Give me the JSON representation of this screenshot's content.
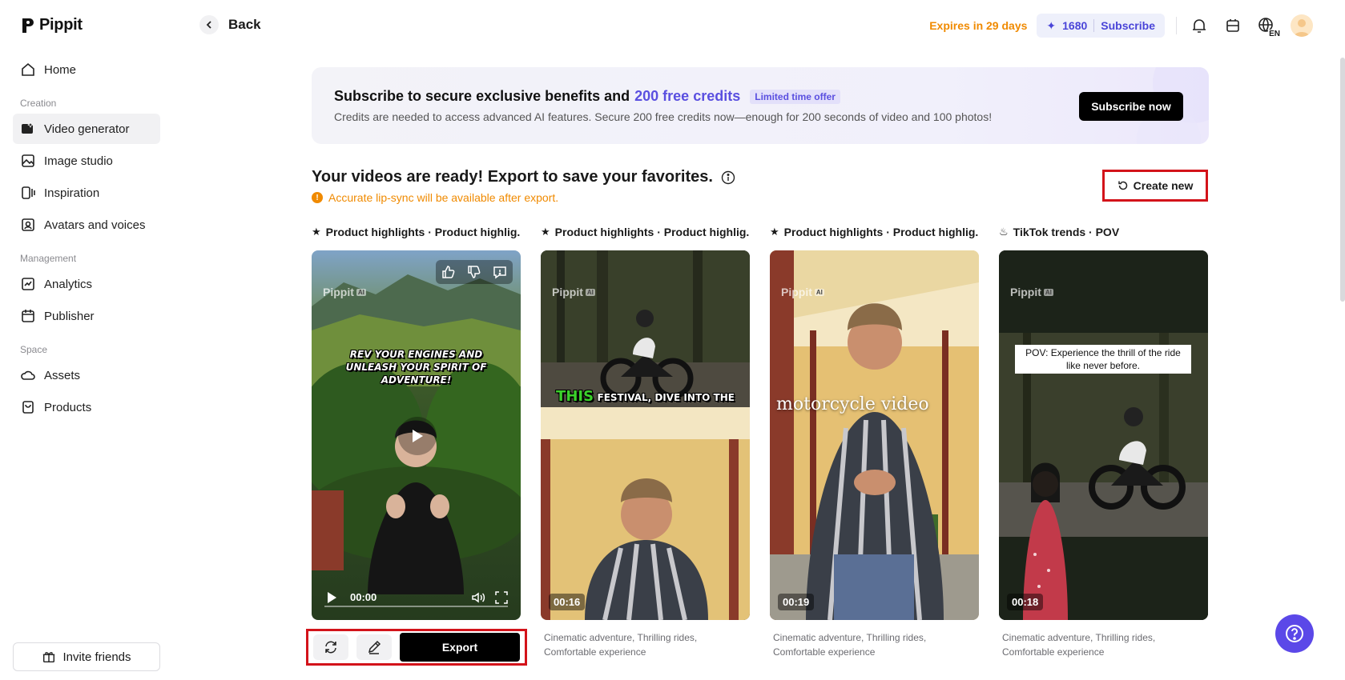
{
  "app": {
    "name": "Pippit"
  },
  "sidebar": {
    "items": [
      {
        "label": "Home"
      },
      {
        "section": "Creation"
      },
      {
        "label": "Video generator",
        "active": true
      },
      {
        "label": "Image studio"
      },
      {
        "label": "Inspiration"
      },
      {
        "label": "Avatars and voices"
      },
      {
        "section": "Management"
      },
      {
        "label": "Analytics"
      },
      {
        "label": "Publisher"
      },
      {
        "section": "Space"
      },
      {
        "label": "Assets"
      },
      {
        "label": "Products"
      }
    ],
    "invite_label": "Invite friends"
  },
  "topbar": {
    "back_label": "Back",
    "expires_text": "Expires in 29 days",
    "credits": "1680",
    "subscribe_label": "Subscribe",
    "language_code": "EN"
  },
  "banner": {
    "title_prefix": "Subscribe to secure exclusive benefits and",
    "title_highlight": "200 free credits",
    "badge": "Limited time offer",
    "subtitle": "Credits are needed to access advanced AI features. Secure 200 free credits now—enough for 200 seconds of video and 100 photos!",
    "cta": "Subscribe now"
  },
  "main": {
    "heading": "Your videos are ready! Export to save your favorites.",
    "warning": "Accurate lip-sync will be available after export.",
    "create_new_label": "Create new"
  },
  "cards": [
    {
      "label": "Product highlights · Product highlig...",
      "watermark": "Pippit",
      "watermark_badge": "AI",
      "caption": "REV YOUR ENGINES AND UNLEASH YOUR SPIRIT OF ADVENTURE!",
      "time": "00:00",
      "description": ""
    },
    {
      "label": "Product highlights · Product highlig...",
      "watermark": "Pippit",
      "watermark_badge": "AI",
      "caption_green": "THIS",
      "caption": "FESTIVAL, DIVE INTO THE",
      "duration": "00:16",
      "description_line1": "Cinematic adventure, Thrilling rides,",
      "description_line2": "Comfortable experience"
    },
    {
      "label": "Product highlights · Product highlig...",
      "watermark": "Pippit",
      "watermark_badge": "AI",
      "caption": "motorcycle video",
      "duration": "00:19",
      "description_line1": "Cinematic adventure, Thrilling rides,",
      "description_line2": "Comfortable experience"
    },
    {
      "label": "TikTok trends · POV",
      "watermark": "Pippit",
      "watermark_badge": "AI",
      "caption": "POV: Experience the thrill of the ride like never before.",
      "duration": "00:18",
      "description_line1": "Cinematic adventure, Thrilling rides,",
      "description_line2": "Comfortable experience"
    }
  ],
  "actions": {
    "export_label": "Export"
  },
  "colors": {
    "accent": "#5a4fe0",
    "warning": "#f08a00",
    "highlight_box": "#d3131a",
    "help_button": "#5b48e8"
  }
}
